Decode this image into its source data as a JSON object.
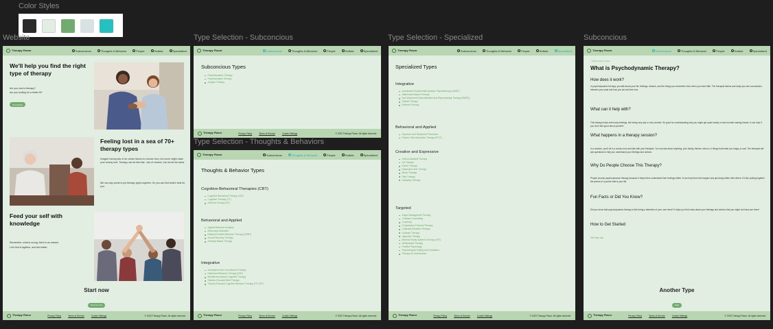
{
  "canvas": {
    "color_styles_label": "Color Styles",
    "swatches": [
      {
        "name": "dark",
        "color": "#2b2b2b"
      },
      {
        "name": "light-mint",
        "color": "#e3eee3"
      },
      {
        "name": "green",
        "color": "#72ab6f"
      },
      {
        "name": "light-gray",
        "color": "#d9e1e2"
      },
      {
        "name": "teal",
        "color": "#27bfbf"
      }
    ]
  },
  "frames": {
    "website": "Website",
    "subconcious_selection": "Type Selection - Subconcious",
    "thoughts_selection": "Type Selection - Thoughts & Behaviors",
    "specialized_selection": "Type Selection - Specialized",
    "subconcious": "Subconcious"
  },
  "nav": {
    "logo": "Therapy Flavor",
    "items": [
      "Subconcious",
      "Thoughts & Behavior",
      "People",
      "Holistic",
      "Specialized"
    ]
  },
  "footer": {
    "logo": "Therapy Flavor",
    "links": [
      "Privacy Policy",
      "Terms of Service",
      "Cookie Settings"
    ],
    "copyright": "© 2023 Therapy Flavor. All rights reserved."
  },
  "home": {
    "hero_title": "We'll help you find the right type of therapy",
    "hero_q1": "Are you new to therapy?",
    "hero_q2": "Are you looking for a better fit?",
    "hero_btn": "Get started",
    "lost_title": "Feeling lost in a sea of 70+ therapy types",
    "lost_p1": "Imagine having lots of ice cream flavors to choose from, but some might make your tummy hurt. Therapy can be like that - lots of choices, but not all the same.",
    "lost_p2": "We can say words to put therapy types together. So you can find what's best for you.",
    "feed_title": "Feed your self with knowledge",
    "feed_p1": "Remember: what is wrong, there is an answer.",
    "feed_p2": "Let's find it together, and feel better.",
    "start_title": "Start now",
    "start_btn": "Find out now"
  },
  "subconcious_sel": {
    "title": "Subconcious Types",
    "items": [
      "Psychodynamic Therapy",
      "Psychoanalytic Therapy",
      "Jungian Therapy"
    ]
  },
  "thoughts_sel": {
    "title": "Thoughts & Behavior Types",
    "groups": [
      {
        "title": "Cognitive-Behavioral Therapies (CBT)",
        "items": [
          "Cognitive Behavioral Therapy (CBT)",
          "Cognitive Therapy (CT)",
          "Schema Therapy (ST)"
        ]
      },
      {
        "title": "Behavioral and Applied",
        "items": [
          "Applied Behavior Analysis",
          "Behavioral Activation",
          "Rational Emotive Behavior Therapy (REBT)",
          "Social Recovery Therapy",
          "Strength Based Therapy"
        ]
      },
      {
        "title": "Integrative",
        "items": [
          "Acceptance and Commitment Therapy",
          "Dialectical Behavior Therapy (DBT)",
          "Mindfulness-Based Cognitive Therapy",
          "Solution-Focused Brief Therapy",
          "Trauma-Focused Cognitive Behavior Therapy (TF-CBT)"
        ]
      }
    ]
  },
  "specialized_sel": {
    "title": "Specialized Types",
    "groups": [
      {
        "title": "Integrative",
        "items": [
          "Accelerated Experiential Dynamic Psychotherapy (AEDP)",
          "Attachment-Based Therapy",
          "Eye Movement Desensitization and Reprocessing Therapy (EMDR)",
          "Gestalt Therapy",
          "Schema Therapy"
        ]
      },
      {
        "title": "Behavioral and Applied",
        "items": [
          "Exposure and Response Prevention",
          "Parent-Child Interaction Therapy (PCIT)"
        ]
      },
      {
        "title": "Creative and Expressive",
        "items": [
          "Animal-Assisted Therapy",
          "Art Therapy",
          "Dance Therapy",
          "Expressive Arts Therapy",
          "Music Therapy",
          "Play Therapy",
          "Sandplay Therapy"
        ]
      },
      {
        "title": "Targeted",
        "items": [
          "Anger Management Therapy",
          "Christian Counseling",
          "Coaching",
          "Compassion-Focused Therapy",
          "Culturally Sensitive Therapy",
          "Gottman Therapy",
          "Hypnosis Therapy",
          "Internal Family Systems Therapy (IFS)",
          "Multicultural Therapy",
          "Positive Psychology",
          "Psychological Testing and Evaluation",
          "Therapy for Adolescents"
        ]
      }
    ]
  },
  "article": {
    "breadcrumb": "< Subconcious Types",
    "title": "What is Psychodynamic Therapy?",
    "sections": [
      {
        "h": "How does it work?",
        "p": "In psychodynamic therapy, you talk about your life, feelings, dreams, and the things you remember from when you were little. The therapist listens and helps you see connections between your past and how you act and feel now."
      },
      {
        "h": "What can it help with?",
        "p": "This therapy helps with many feelings, like being very sad or very worried. It's good for understanding why you might get upset easily or have trouble making friends. It can help if you don't feel good about yourself."
      },
      {
        "h": "What happens in a therapy session?",
        "p": "In a session, you'll sit in a comfy room and talk with your therapist. You can talk about anything: your family, friends, school, or things that make you happy or sad. The therapist will ask questions to help you understand your feelings and actions."
      },
      {
        "h": "Why Do People Choose This Therapy?",
        "p": "People choose psychodynamic therapy because it helps them understand their feelings better. It can help them feel happier and get along better with others. It's like putting together the pieces of a puzzle that is your life."
      },
      {
        "h": "Fun Facts or Did You Know?",
        "p": "Did you know that psychodynamic therapy is like being a detective of your own mind? It helps you find clues about your feelings and actions that you might not know are there!"
      },
      {
        "h": "How to Get Started",
        "p": ""
      }
    ],
    "get_started_link": "Get help now",
    "another_title": "Another Type",
    "another_btn": "Help"
  }
}
